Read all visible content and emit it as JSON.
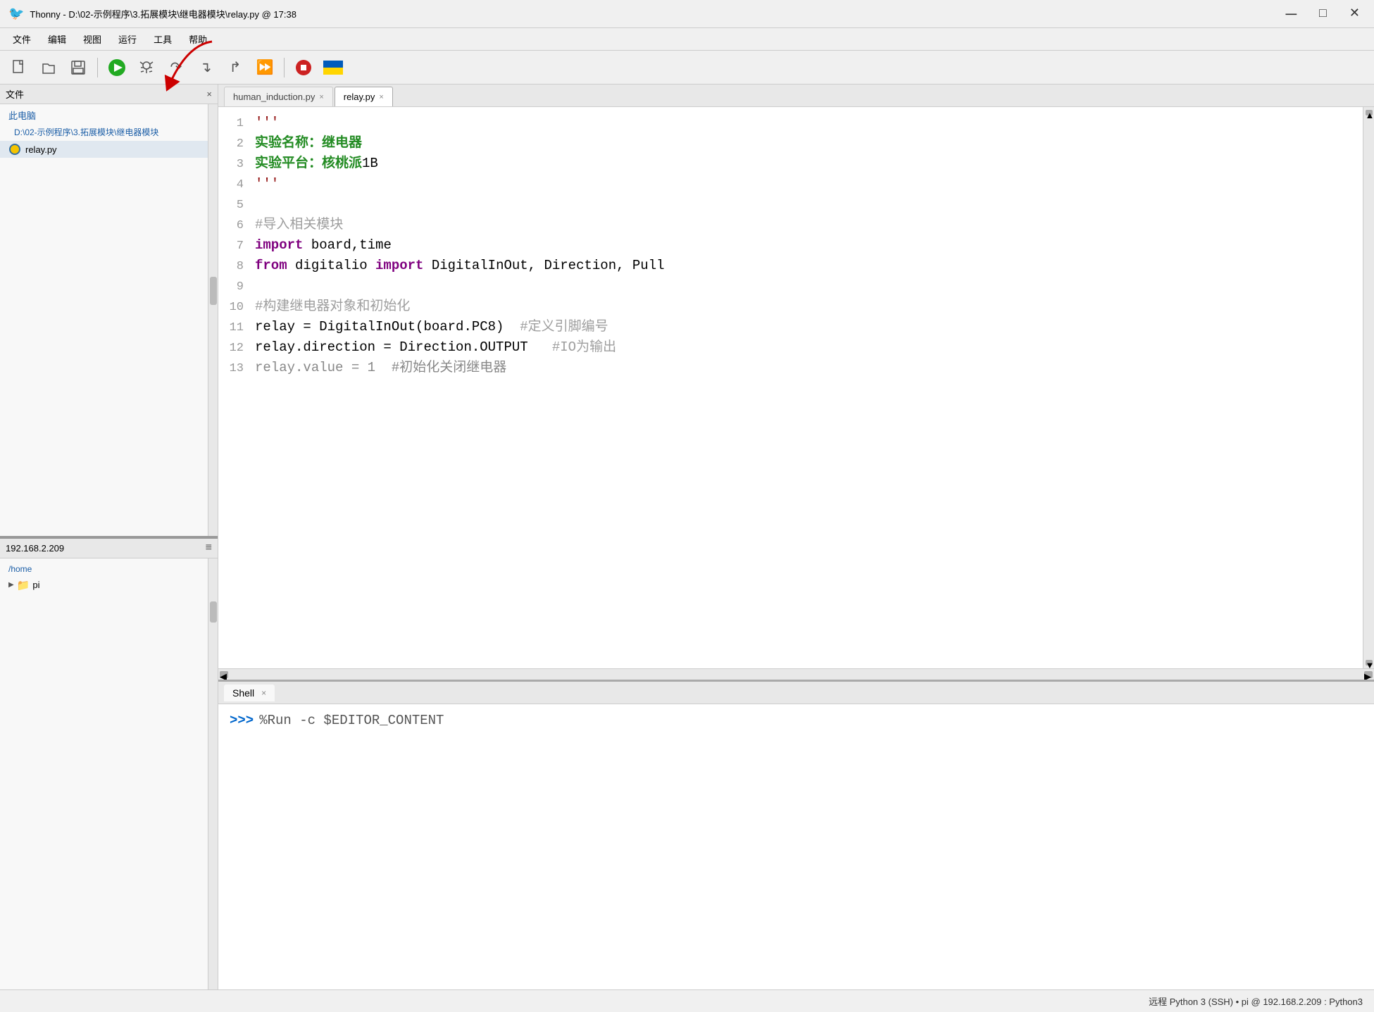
{
  "titleBar": {
    "icon": "🐦",
    "title": "Thonny - D:\\02-示例程序\\3.拓展模块\\继电器模块\\relay.py @ 17:38",
    "minimizeLabel": "─",
    "maximizeLabel": "□",
    "closeLabel": "✕"
  },
  "menuBar": {
    "items": [
      "文件",
      "编辑",
      "视图",
      "运行",
      "工具",
      "帮助"
    ]
  },
  "sidebar": {
    "localHeader": "文件",
    "closeLocal": "×",
    "computerLabel": "此电脑",
    "pathLabel": "D:\\02-示例程序\\3.拓展模块\\继电器模块",
    "fileItem": "relay.py",
    "remoteAddress": "192.168.2.209",
    "remotePath": "/home",
    "remoteTreeItem": "pi"
  },
  "tabs": [
    {
      "label": "human_induction.py",
      "active": false,
      "close": "×"
    },
    {
      "label": "relay.py",
      "active": true,
      "close": "×"
    }
  ],
  "code": {
    "lines": [
      {
        "num": 1,
        "content": "'''",
        "type": "string"
      },
      {
        "num": 2,
        "content": "实验名称：继电器",
        "type": "green"
      },
      {
        "num": 3,
        "content": "实验平台：核桃派1B",
        "type": "green"
      },
      {
        "num": 4,
        "content": "'''",
        "type": "string"
      },
      {
        "num": 5,
        "content": "",
        "type": "normal"
      },
      {
        "num": 6,
        "content": "#导入相关模块",
        "type": "comment"
      },
      {
        "num": 7,
        "content": "import board,time",
        "type": "import"
      },
      {
        "num": 8,
        "content": "from digitalio import DigitalInOut, Direction, Pull",
        "type": "from_import"
      },
      {
        "num": 9,
        "content": "",
        "type": "normal"
      },
      {
        "num": 10,
        "content": "#构建继电器对象和初始化",
        "type": "comment"
      },
      {
        "num": 11,
        "content": "relay = DigitalInOut(board.PC8)  #定义引脚编号",
        "type": "code_comment"
      },
      {
        "num": 12,
        "content": "relay.direction = Direction.OUTPUT   #IO为输出",
        "type": "code_comment"
      },
      {
        "num": 13,
        "content": "relay.value = 1  #初始化关闭继电器",
        "type": "code_comment_partial"
      }
    ]
  },
  "shell": {
    "tabLabel": "Shell",
    "tabClose": "×",
    "promptSymbol": ">>>",
    "promptCommand": "%Run -c $EDITOR_CONTENT"
  },
  "statusBar": {
    "text": "远程 Python 3 (SSH) • pi @ 192.168.2.209 : Python3"
  },
  "toolbar": {
    "buttons": [
      {
        "name": "new-file-btn",
        "icon": "📄",
        "label": "新建"
      },
      {
        "name": "open-file-btn",
        "icon": "📂",
        "label": "打开"
      },
      {
        "name": "save-btn",
        "icon": "💾",
        "label": "保存"
      },
      {
        "name": "run-btn",
        "icon": "▶",
        "label": "运行",
        "color": "#22aa22"
      },
      {
        "name": "debug-btn",
        "icon": "🐛",
        "label": "调试"
      },
      {
        "name": "step-over-btn",
        "icon": "↷",
        "label": "步过"
      },
      {
        "name": "step-into-btn",
        "icon": "↴",
        "label": "步入"
      },
      {
        "name": "step-out-btn",
        "icon": "↱",
        "label": "步出"
      },
      {
        "name": "continue-btn",
        "icon": "⏩",
        "label": "继续"
      },
      {
        "name": "stop-btn",
        "icon": "⏹",
        "label": "停止",
        "color": "#cc2222"
      },
      {
        "name": "ukraine-flag-btn",
        "icon": "🇺🇦",
        "label": "乌克兰"
      }
    ]
  }
}
